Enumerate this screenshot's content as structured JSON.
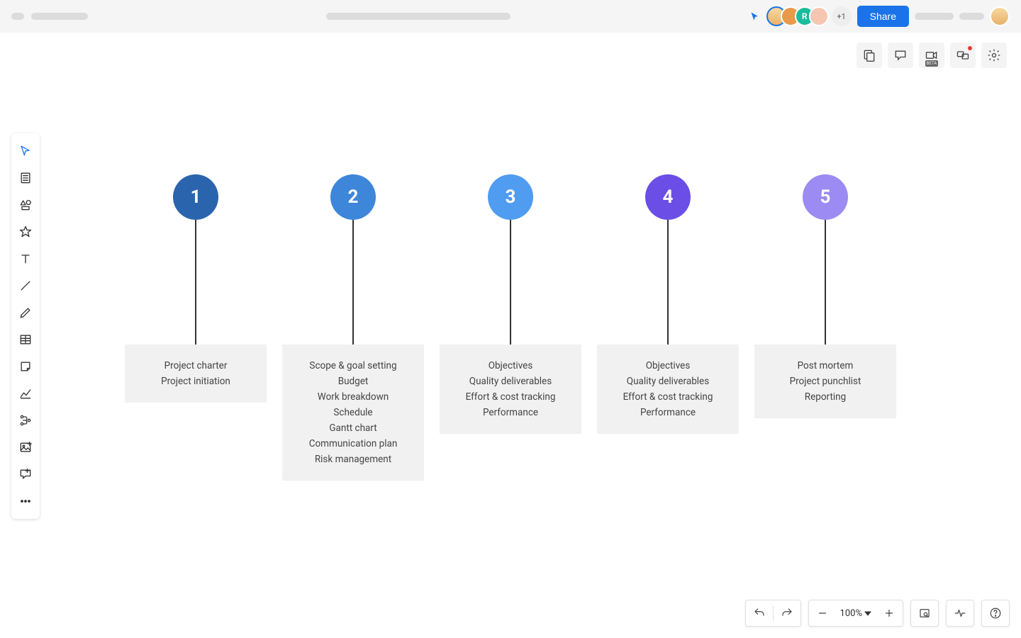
{
  "header": {
    "avatar_more": "+1",
    "share_label": "Share",
    "avatar_letters": [
      "",
      "",
      "R",
      ""
    ],
    "avatar_colors": [
      "#f4c77b",
      "#e67e22",
      "#1abc9c",
      "#f5b7b1"
    ]
  },
  "quick_actions": {
    "beta_label": "BETA"
  },
  "bottombar": {
    "zoom": "100%"
  },
  "diagram": {
    "columns": [
      {
        "num": "1",
        "color": "#2a64ad",
        "items": [
          "Project charter",
          "Project initiation"
        ]
      },
      {
        "num": "2",
        "color": "#3d86d9",
        "items": [
          "Scope & goal setting",
          "Budget",
          "Work breakdown",
          "Schedule",
          "Gantt chart",
          "Communication plan",
          "Risk management"
        ]
      },
      {
        "num": "3",
        "color": "#4f9cf0",
        "items": [
          "Objectives",
          "Quality deliverables",
          "Effort & cost tracking",
          "Performance"
        ]
      },
      {
        "num": "4",
        "color": "#6a4ee6",
        "items": [
          "Objectives",
          "Quality deliverables",
          "Effort & cost tracking",
          "Performance"
        ]
      },
      {
        "num": "5",
        "color": "#9b8bf2",
        "items": [
          "Post mortem",
          "Project punchlist",
          "Reporting"
        ]
      }
    ]
  }
}
